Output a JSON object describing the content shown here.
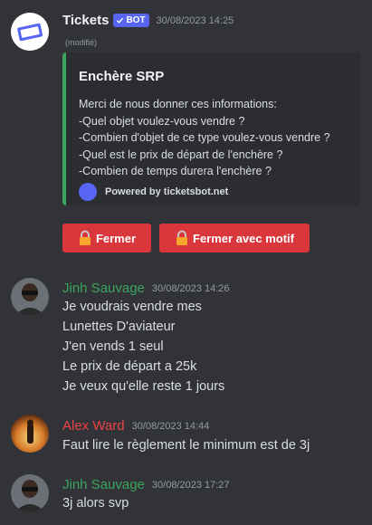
{
  "colors": {
    "background": "#313338",
    "embed_border": "#3ba55c",
    "button_danger": "#da373c",
    "bot_tag": "#5865f2",
    "author_jinh": "#3ba55c",
    "author_alex": "#ed4245"
  },
  "bot_message": {
    "author": "Tickets",
    "bot_tag": "BOT",
    "timestamp": "30/08/2023 14:25",
    "edited": "(modifié)",
    "avatar_icon": "ticket-icon",
    "embed": {
      "title": "Enchère SRP",
      "lines": [
        "Merci de nous donner ces informations:",
        "-Quel objet voulez-vous vendre ?",
        "-Combien d'objet de ce type voulez-vous vendre ?",
        "-Quel est le prix de départ de l'enchère ?",
        "-Combien de temps durera l'enchère ?"
      ],
      "footer": "Powered by ticketsbot.net"
    },
    "buttons": [
      {
        "label": "Fermer",
        "icon": "lock-icon"
      },
      {
        "label": "Fermer avec motif",
        "icon": "lock-icon"
      }
    ]
  },
  "messages": [
    {
      "author": "Jinh Sauvage",
      "timestamp": "30/08/2023 14:26",
      "lines": [
        "Je voudrais vendre mes",
        "Lunettes D'aviateur",
        "J'en vends 1 seul",
        "Le prix de départ a 25k",
        "Je veux qu'elle reste 1 jours"
      ]
    },
    {
      "author": "Alex Ward",
      "timestamp": "30/08/2023 14:44",
      "lines": [
        "Faut lire le règlement le minimum est de 3j"
      ]
    },
    {
      "author": "Jinh Sauvage",
      "timestamp": "30/08/2023 17:27",
      "lines": [
        "3j alors svp"
      ]
    }
  ]
}
